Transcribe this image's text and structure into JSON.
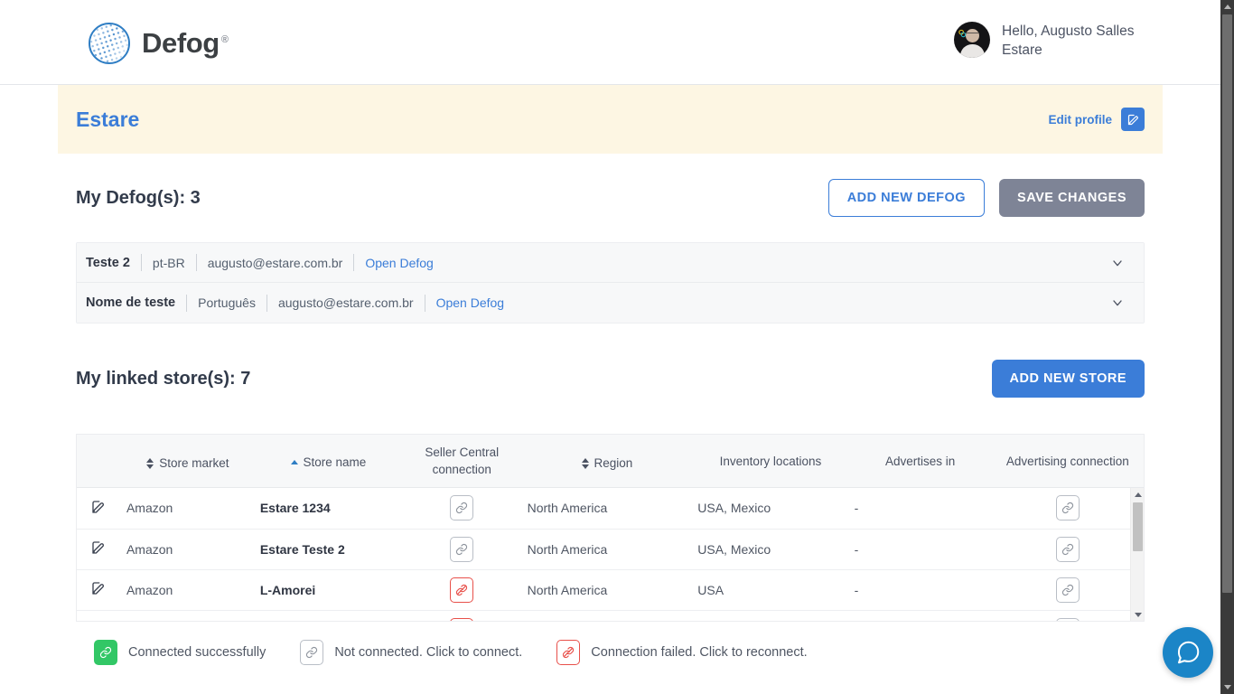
{
  "header": {
    "brand": "Defog",
    "brand_mark": "defog-logo-icon",
    "registered": "®",
    "greeting": "Hello, Augusto Salles Estare"
  },
  "banner": {
    "title": "Estare",
    "edit_profile_label": "Edit profile",
    "edit_icon": "edit-pencil-icon"
  },
  "defog_section": {
    "title": "My Defog(s): 3",
    "add_button": "ADD NEW DEFOG",
    "save_button": "SAVE CHANGES",
    "rows": [
      {
        "name": "Teste 2",
        "locale": "pt-BR",
        "email": "augusto@estare.com.br",
        "link": "Open Defog",
        "chevron": "chevron-down-icon"
      },
      {
        "name": "Nome de teste",
        "locale": "Português",
        "email": "augusto@estare.com.br",
        "link": "Open Defog",
        "chevron": "chevron-down-icon"
      }
    ]
  },
  "store_section": {
    "title": "My linked store(s): 7",
    "add_button": "ADD NEW STORE",
    "columns": [
      {
        "label": "",
        "sort": "none"
      },
      {
        "label": "Store market",
        "sort": "both"
      },
      {
        "label": "Store name",
        "sort": "asc"
      },
      {
        "label": "Seller Central connection",
        "sort": "none"
      },
      {
        "label": "Region",
        "sort": "both"
      },
      {
        "label": "Inventory locations",
        "sort": "none"
      },
      {
        "label": "Advertises in",
        "sort": "none"
      },
      {
        "label": "Advertising connection",
        "sort": "none"
      }
    ],
    "rows": [
      {
        "edit_icon": "edit-pencil-icon",
        "market": "Amazon",
        "name": "Estare 1234",
        "seller_central": "not-connected",
        "region": "North America",
        "inventory": "USA, Mexico",
        "advertises": "-",
        "advertising": "not-connected"
      },
      {
        "edit_icon": "edit-pencil-icon",
        "market": "Amazon",
        "name": "Estare Teste 2",
        "seller_central": "not-connected",
        "region": "North America",
        "inventory": "USA, Mexico",
        "advertises": "-",
        "advertising": "not-connected"
      },
      {
        "edit_icon": "edit-pencil-icon",
        "market": "Amazon",
        "name": "L-Amorei",
        "seller_central": "failed",
        "region": "North America",
        "inventory": "USA",
        "advertises": "-",
        "advertising": "not-connected"
      },
      {
        "edit_icon": "edit-pencil-icon",
        "market": "",
        "name": "",
        "seller_central": "failed",
        "region": "",
        "inventory": "",
        "advertises": "",
        "advertising": "not-connected"
      }
    ],
    "scrollbar": {
      "up_arrow": "scroll-up-arrow-icon",
      "down_arrow": "scroll-down-arrow-icon"
    }
  },
  "legend": [
    {
      "state": "connected",
      "text": "Connected successfully"
    },
    {
      "state": "not-connected",
      "text": "Not connected. Click to connect."
    },
    {
      "state": "failed",
      "text": "Connection failed. Click to reconnect."
    }
  ],
  "chat": {
    "icon": "chat-bubble-icon"
  },
  "colors": {
    "brand_blue": "#3b7dd8",
    "banner_bg": "#fdf6e3",
    "muted_button": "#7e8496",
    "success_green": "#32c766",
    "error_red": "#e8504a",
    "chat_blue": "#1b85c7"
  }
}
